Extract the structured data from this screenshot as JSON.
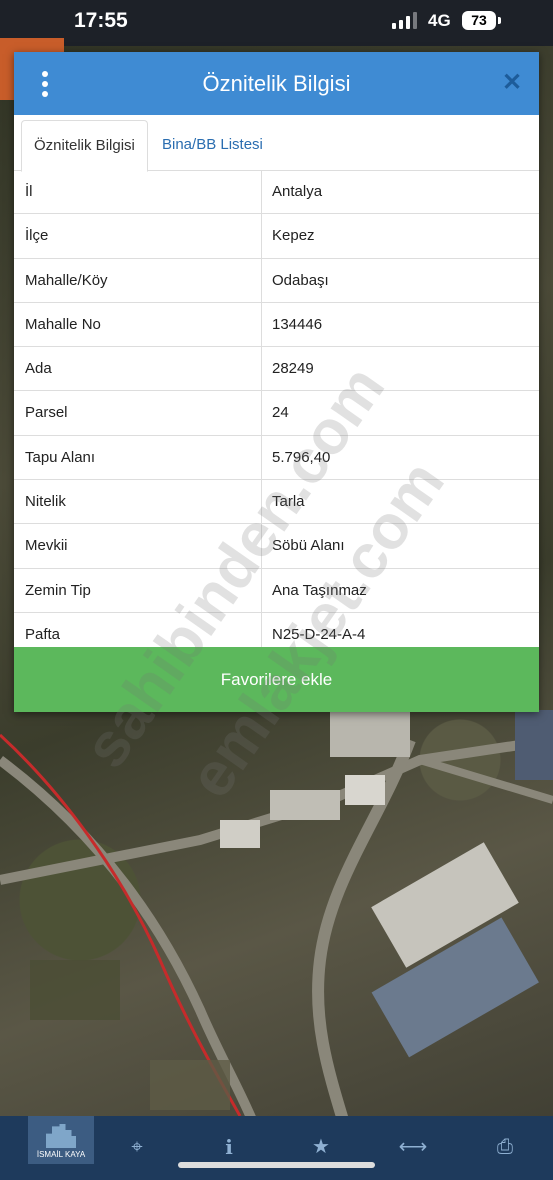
{
  "status_bar": {
    "time": "17:55",
    "network": "4G",
    "battery": "73"
  },
  "modal": {
    "title": "Öznitelik Bilgisi",
    "tabs": [
      {
        "label": "Öznitelik Bilgisi",
        "active": true
      },
      {
        "label": "Bina/BB Listesi",
        "active": false
      }
    ],
    "rows": [
      {
        "key": "İl",
        "value": "Antalya"
      },
      {
        "key": "İlçe",
        "value": "Kepez"
      },
      {
        "key": "Mahalle/Köy",
        "value": "Odabaşı"
      },
      {
        "key": "Mahalle No",
        "value": "134446"
      },
      {
        "key": "Ada",
        "value": "28249"
      },
      {
        "key": "Parsel",
        "value": "24"
      },
      {
        "key": "Tapu Alanı",
        "value": "5.796,40"
      },
      {
        "key": "Nitelik",
        "value": "Tarla"
      },
      {
        "key": "Mevkii",
        "value": "Söbü Alanı"
      },
      {
        "key": "Zemin Tip",
        "value": "Ana Taşınmaz"
      },
      {
        "key": "Pafta",
        "value": "N25-D-24-A-4"
      }
    ],
    "favorite_button": "Favorilere ekle"
  },
  "watermarks": [
    "sahibinden.com",
    "emlakjet.com"
  ],
  "bottom_bar": {
    "logo_text": "İSMAİL KAYA",
    "icons": [
      "crosshair-icon",
      "info-icon",
      "star-icon",
      "measure-icon",
      "print-icon"
    ]
  },
  "colors": {
    "header": "#3f8bd3",
    "button": "#5cb85c",
    "bottom_bar": "#1e3a5c"
  }
}
